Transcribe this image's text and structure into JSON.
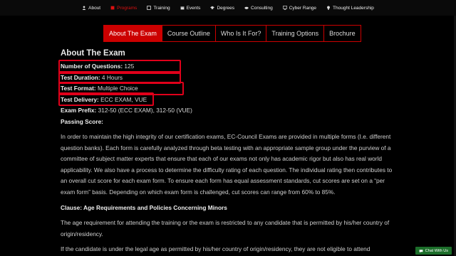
{
  "nav": [
    {
      "label": "About",
      "icon": "user-icon",
      "active": false
    },
    {
      "label": "Programs",
      "icon": "book-icon",
      "active": true
    },
    {
      "label": "Training",
      "icon": "training-icon",
      "active": false
    },
    {
      "label": "Events",
      "icon": "calendar-icon",
      "active": false
    },
    {
      "label": "Degrees",
      "icon": "graduation-icon",
      "active": false
    },
    {
      "label": "Consulting",
      "icon": "handshake-icon",
      "active": false
    },
    {
      "label": "Cyber Range",
      "icon": "monitor-icon",
      "active": false
    },
    {
      "label": "Thought Leadership",
      "icon": "lightbulb-icon",
      "active": false
    }
  ],
  "tabs": [
    "About The Exam",
    "Course Outline",
    "Who Is It For?",
    "Training Options",
    "Brochure"
  ],
  "content": {
    "title": "About The Exam",
    "facts": [
      {
        "label": "Number of Questions:",
        "value": " 125"
      },
      {
        "label": "Test Duration:",
        "value": " 4 Hours"
      },
      {
        "label": "Test Format:",
        "value": " Multiple Choice"
      },
      {
        "label": "Test Delivery:",
        "value": " ECC EXAM, VUE"
      },
      {
        "label": "Exam Prefix:",
        "value": " 312-50 (ECC EXAM), 312-50 (VUE)"
      }
    ],
    "passing_label": "Passing Score:",
    "para1": "In order to maintain the high integrity of our certification exams, EC-Council Exams are provided in multiple forms (I.e. different question banks). Each form is carefully analyzed through beta testing with an appropriate sample group under the purview of a committee of subject matter experts that ensure that each of our exams not only has academic rigor but also has real world applicability. We also have a process to determine the difficulty rating of each question. The individual rating then contributes to an overall cut score for each exam form. To ensure each form has equal assessment standards, cut scores are set on a “per exam form” basis. Depending on which exam form is challenged, cut scores can range from 60% to 85%.",
    "clause_title": "Clause: Age Requirements and Policies Concerning Minors",
    "para2": "The age requirement for attending the training or the exam is restricted to any candidate that is permitted by his/her country of origin/residency.",
    "para3": "If the candidate is under the legal age as permitted by his/her country of origin/residency, they are not eligible to attend"
  },
  "chat_label": "Chat With Us",
  "colors": {
    "accent": "#cc0000",
    "highlight": "#e0001a",
    "chat": "#1c6e2a"
  }
}
